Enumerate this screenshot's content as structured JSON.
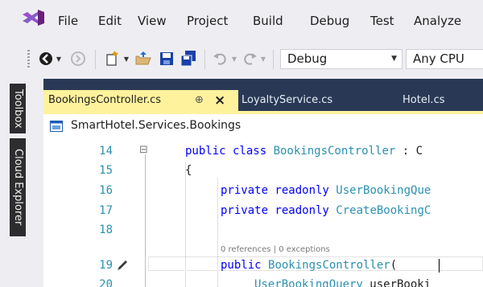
{
  "menu": {
    "items": [
      "File",
      "Edit",
      "View",
      "Project",
      "Build",
      "Debug",
      "Test",
      "Analyze"
    ]
  },
  "toolbar": {
    "configuration": "Debug",
    "platform": "Any CPU"
  },
  "side_tabs": [
    "Toolbox",
    "Cloud Explorer"
  ],
  "tabs": [
    {
      "label": "BookingsController.cs",
      "pin": "⊕",
      "close": "×",
      "active": true
    },
    {
      "label": "LoyaltyService.cs",
      "active": false
    },
    {
      "label": "Hotel.cs",
      "active": false
    }
  ],
  "navbar": {
    "project": "SmartHotel.Services.Bookings"
  },
  "code": {
    "collapse_glyph": "⊟",
    "lines": [
      {
        "n": "14",
        "kw1": "public class ",
        "type": "BookingsController",
        "rest": " : C"
      },
      {
        "n": "15",
        "text": "{"
      },
      {
        "n": "16",
        "kw1": "private readonly ",
        "type": "UserBookingQue"
      },
      {
        "n": "17",
        "kw1": "private readonly ",
        "type": "CreateBookingC"
      },
      {
        "n": "18"
      },
      {
        "n": "19",
        "kw1": "public ",
        "type": "BookingsController",
        "rest": "("
      },
      {
        "n": "20",
        "type": "UserBookingQuery",
        "rest": " userBooki"
      }
    ],
    "codelens": "0 references | 0 exceptions"
  },
  "colors": {
    "accent_tab": "#fff29d",
    "frame": "#293955",
    "keyword": "#0000ff",
    "type": "#2b91af"
  }
}
